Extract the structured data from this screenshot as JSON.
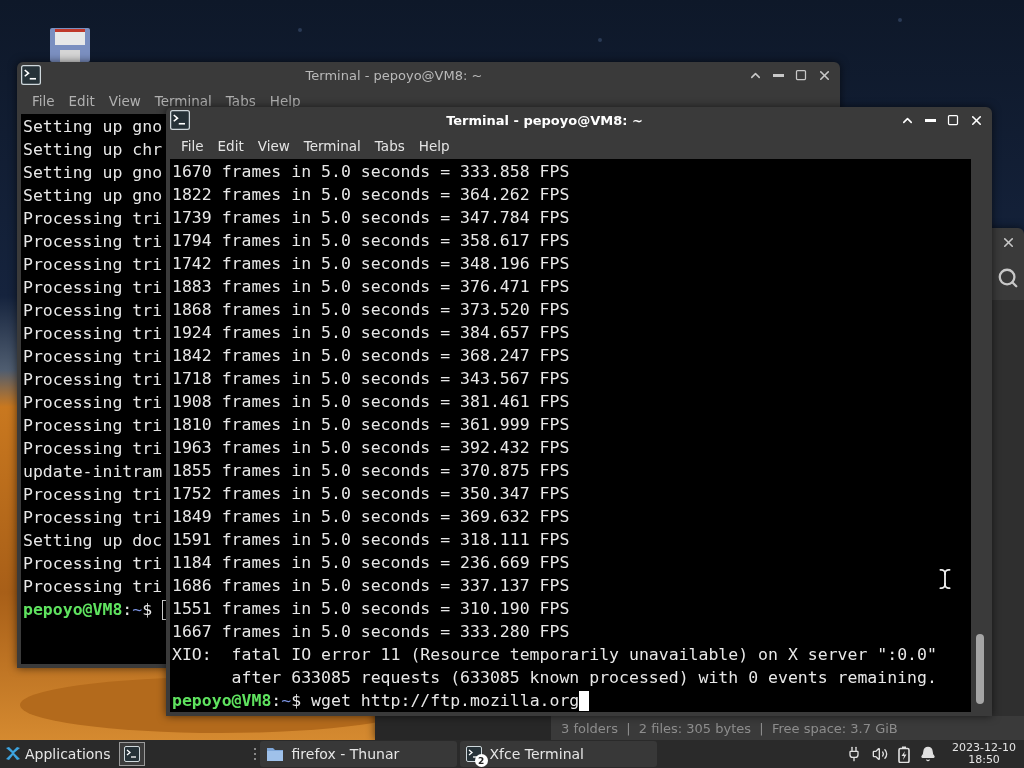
{
  "back_terminal": {
    "title": "Terminal - pepoyo@VM8: ~",
    "focused": false,
    "menu": [
      "File",
      "Edit",
      "View",
      "Terminal",
      "Tabs",
      "Help"
    ],
    "lines": [
      "Setting up gno",
      "Setting up chr",
      "Setting up gno",
      "Setting up gno",
      "Processing tri",
      "Processing tri",
      "Processing tri",
      "Processing tri",
      "Processing tri",
      "Processing tri",
      "Processing tri",
      "Processing tri",
      "Processing tri",
      "Processing tri",
      "Processing tri",
      "update-initram",
      "Processing tri",
      "Processing tri",
      "Setting up doc",
      "Processing tri",
      "Processing tri"
    ],
    "prompt": {
      "user": "pepoyo@VM8",
      "separator": ":",
      "path": "~",
      "symbol": "$"
    }
  },
  "file_manager": {
    "status_bar": "3 folders  |  2 files: 305 bytes  |  Free space: 3.7 GiB"
  },
  "front_terminal": {
    "title": "Terminal - pepoyo@VM8: ~",
    "focused": true,
    "menu": [
      "File",
      "Edit",
      "View",
      "Terminal",
      "Tabs",
      "Help"
    ],
    "lines": [
      "1670 frames in 5.0 seconds = 333.858 FPS",
      "1822 frames in 5.0 seconds = 364.262 FPS",
      "1739 frames in 5.0 seconds = 347.784 FPS",
      "1794 frames in 5.0 seconds = 358.617 FPS",
      "1742 frames in 5.0 seconds = 348.196 FPS",
      "1883 frames in 5.0 seconds = 376.471 FPS",
      "1868 frames in 5.0 seconds = 373.520 FPS",
      "1924 frames in 5.0 seconds = 384.657 FPS",
      "1842 frames in 5.0 seconds = 368.247 FPS",
      "1718 frames in 5.0 seconds = 343.567 FPS",
      "1908 frames in 5.0 seconds = 381.461 FPS",
      "1810 frames in 5.0 seconds = 361.999 FPS",
      "1963 frames in 5.0 seconds = 392.432 FPS",
      "1855 frames in 5.0 seconds = 370.875 FPS",
      "1752 frames in 5.0 seconds = 350.347 FPS",
      "1849 frames in 5.0 seconds = 369.632 FPS",
      "1591 frames in 5.0 seconds = 318.111 FPS",
      "1184 frames in 5.0 seconds = 236.669 FPS",
      "1686 frames in 5.0 seconds = 337.137 FPS",
      "1551 frames in 5.0 seconds = 310.190 FPS",
      "1667 frames in 5.0 seconds = 333.280 FPS",
      "XIO:  fatal IO error 11 (Resource temporarily unavailable) on X server \":0.0\"",
      "      after 633085 requests (633085 known processed) with 0 events remaining."
    ],
    "prompt": {
      "user": "pepoyo@VM8",
      "separator": ":",
      "path": "~",
      "symbol": "$",
      "command": "wget http://ftp.mozilla.org"
    }
  },
  "taskbar": {
    "menu_label": "Applications",
    "tasks": [
      {
        "label": "firefox - Thunar",
        "kind": "folder",
        "selected": false
      },
      {
        "label": "Xfce Terminal",
        "kind": "terminal",
        "count": "2",
        "selected": false
      }
    ],
    "clock": {
      "date": "2023-12-10",
      "time": "18:50"
    }
  }
}
